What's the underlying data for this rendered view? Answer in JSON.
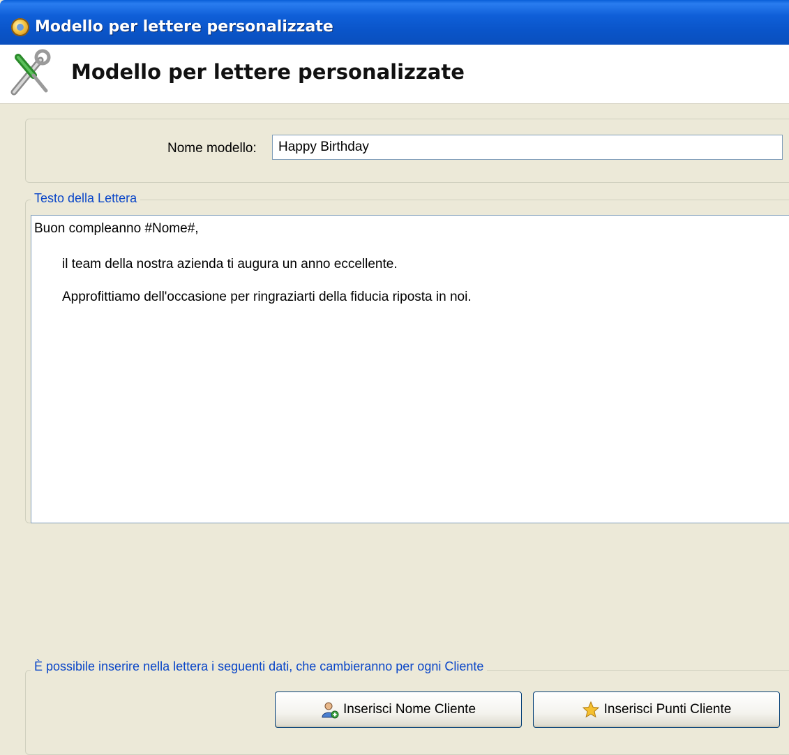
{
  "window": {
    "title": "Modello per lettere personalizzate"
  },
  "header": {
    "title": "Modello per lettere personalizzate",
    "icon": "tools-icon"
  },
  "form": {
    "name_label": "Nome modello:",
    "name_value": "Happy Birthday"
  },
  "letter": {
    "legend": "Testo della Lettera",
    "lines": [
      "Buon compleanno #Nome#,",
      "il team della nostra azienda ti augura un anno eccellente.",
      "Approfittiamo dell'occasione per ringraziarti della fiducia riposta in noi."
    ]
  },
  "fields": {
    "legend": "È possibile inserire nella lettera i seguenti dati, che cambieranno per ogni Cliente",
    "insert_name_label": "Inserisci Nome Cliente",
    "insert_points_label": "Inserisci Punti Cliente"
  },
  "colors": {
    "titlebar": "#0a54c8",
    "legend_text": "#0a46c8",
    "background": "#ece9d8"
  }
}
